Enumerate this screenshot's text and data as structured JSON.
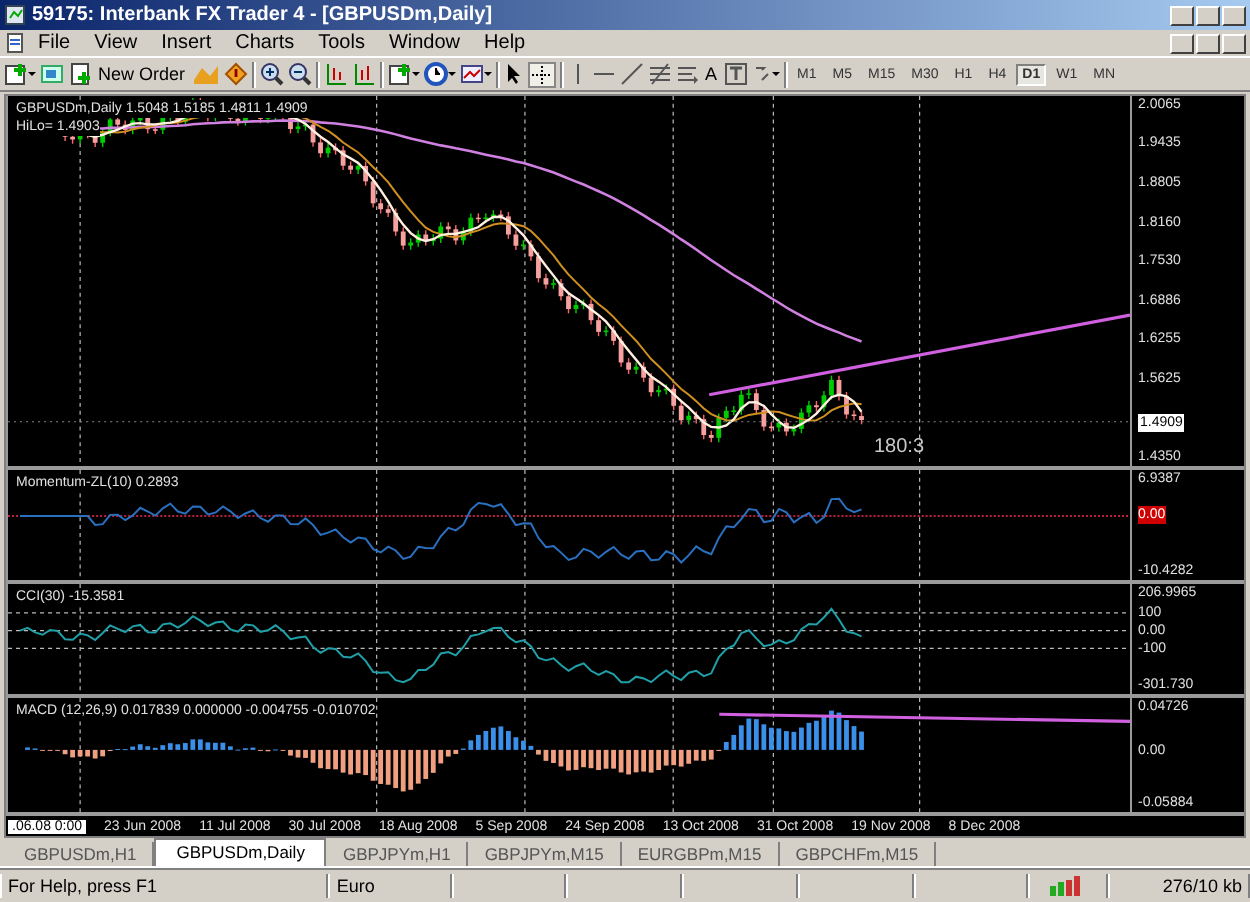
{
  "window": {
    "title": "59175: Interbank FX Trader 4 - [GBPUSDm,Daily]"
  },
  "menu": [
    "File",
    "View",
    "Insert",
    "Charts",
    "Tools",
    "Window",
    "Help"
  ],
  "toolbar": {
    "new_order": "New Order",
    "text_tool": "A",
    "timeframes": [
      {
        "label": "M1",
        "selected": false
      },
      {
        "label": "M5",
        "selected": false
      },
      {
        "label": "M15",
        "selected": false
      },
      {
        "label": "M30",
        "selected": false
      },
      {
        "label": "H1",
        "selected": false
      },
      {
        "label": "H4",
        "selected": false
      },
      {
        "label": "D1",
        "selected": true
      },
      {
        "label": "W1",
        "selected": false
      },
      {
        "label": "MN",
        "selected": false
      }
    ]
  },
  "panes": [
    {
      "kind": "price",
      "labels": [
        "GBPUSDm,Daily  1.5048 1.5185 1.4811 1.4909",
        "HiLo= 1.4903"
      ],
      "annotation": "180:3",
      "axis": [
        {
          "text": "2.0065",
          "kind": "tick"
        },
        {
          "text": "1.9435",
          "kind": "tick"
        },
        {
          "text": "1.8805",
          "kind": "tick"
        },
        {
          "text": "1.8160",
          "kind": "tick"
        },
        {
          "text": "1.7530",
          "kind": "tick"
        },
        {
          "text": "1.6886",
          "kind": "tick"
        },
        {
          "text": "1.6255",
          "kind": "tick"
        },
        {
          "text": "1.5625",
          "kind": "tick"
        },
        {
          "text": "1.4909",
          "kind": "current"
        },
        {
          "text": "1.4350",
          "kind": "tick"
        }
      ]
    },
    {
      "kind": "momentum",
      "labels": [
        "Momentum-ZL(10) 0.2893"
      ],
      "axis": [
        {
          "text": "6.9387",
          "kind": "tick"
        },
        {
          "text": "0.00",
          "kind": "marker"
        },
        {
          "text": "-10.4282",
          "kind": "tick"
        }
      ]
    },
    {
      "kind": "cci",
      "labels": [
        "CCI(30) -15.3581"
      ],
      "axis": [
        {
          "text": "206.9965",
          "kind": "tick"
        },
        {
          "text": "100",
          "kind": "tick"
        },
        {
          "text": "0.00",
          "kind": "tick"
        },
        {
          "text": "-100",
          "kind": "tick"
        },
        {
          "text": "-301.730",
          "kind": "tick"
        }
      ]
    },
    {
      "kind": "macd",
      "labels": [
        "MACD  (12,26,9) 0.017839 0.000000 -0.004755 -0.010702"
      ],
      "axis": [
        {
          "text": "0.04726",
          "kind": "tick"
        },
        {
          "text": "0.00",
          "kind": "tick"
        },
        {
          "text": "-0.05884",
          "kind": "tick"
        }
      ]
    }
  ],
  "time_axis": [
    {
      "text": ".06.08 0:00",
      "kind": "cursor"
    },
    {
      "text": "23 Jun 2008",
      "kind": "tick"
    },
    {
      "text": "11 Jul 2008",
      "kind": "tick"
    },
    {
      "text": "30 Jul 2008",
      "kind": "tick"
    },
    {
      "text": "18 Aug 2008",
      "kind": "tick"
    },
    {
      "text": "5 Sep 2008",
      "kind": "tick"
    },
    {
      "text": "24 Sep 2008",
      "kind": "tick"
    },
    {
      "text": "13 Oct 2008",
      "kind": "tick"
    },
    {
      "text": "31 Oct 2008",
      "kind": "tick"
    },
    {
      "text": "19 Nov 2008",
      "kind": "tick"
    },
    {
      "text": "8 Dec 2008",
      "kind": "tick"
    }
  ],
  "tabs": [
    {
      "label": "GBPUSDm,H1",
      "selected": false
    },
    {
      "label": "GBPUSDm,Daily",
      "selected": true
    },
    {
      "label": "GBPJPYm,H1",
      "selected": false
    },
    {
      "label": "GBPJPYm,M15",
      "selected": false
    },
    {
      "label": "EURGBPm,M15",
      "selected": false
    },
    {
      "label": "GBPCHFm,M15",
      "selected": false
    }
  ],
  "status_bar": {
    "help": "For Help, press F1",
    "profile": "Euro",
    "traffic": "276/10 kb"
  }
}
